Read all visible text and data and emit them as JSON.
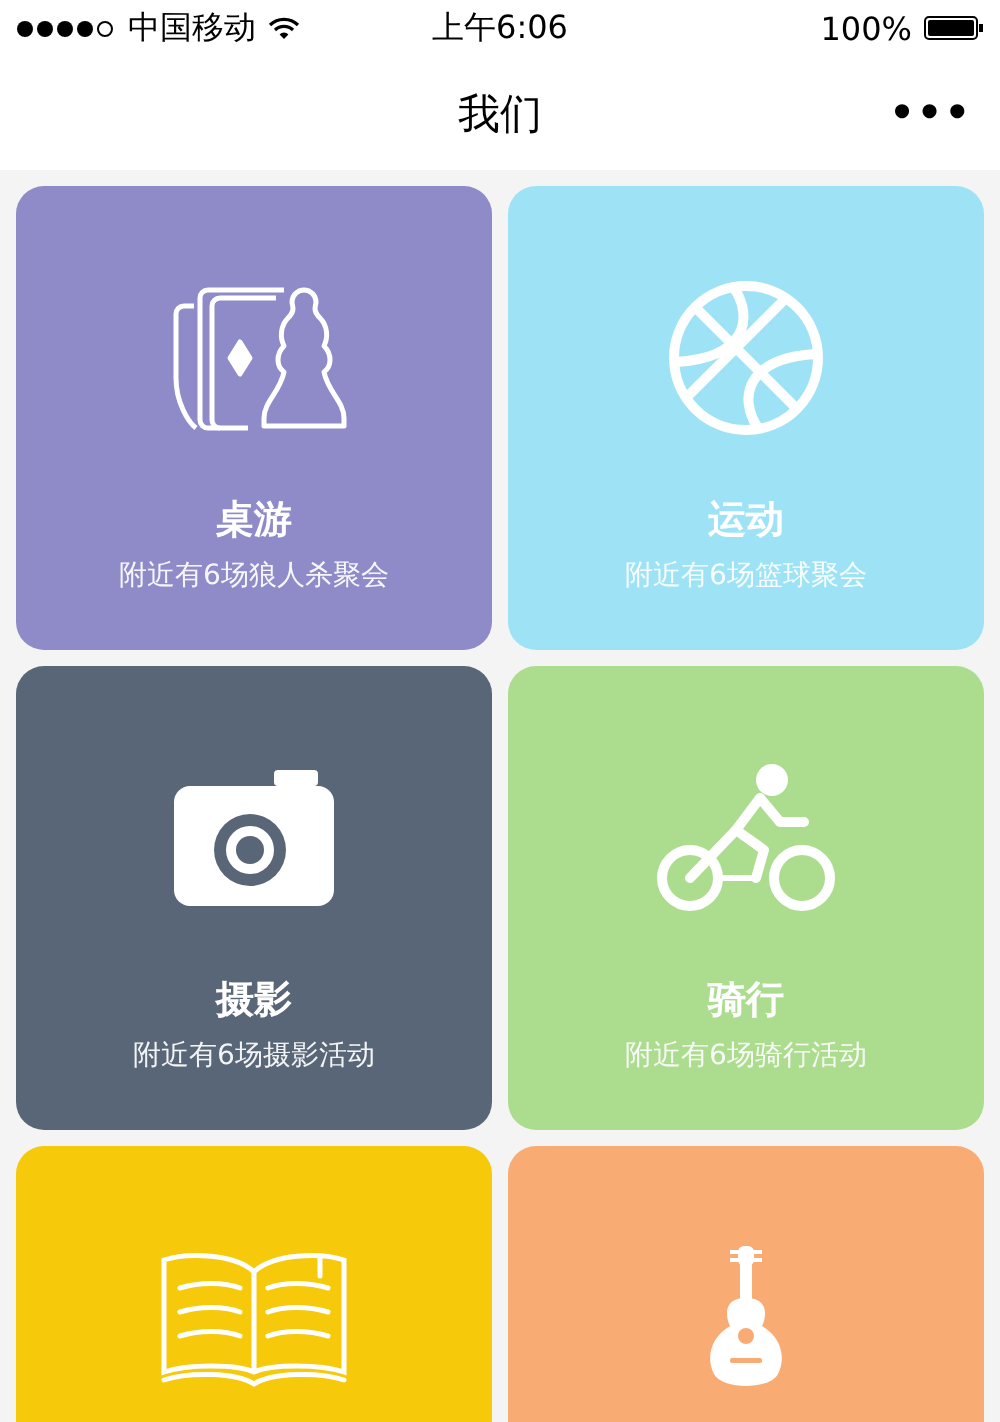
{
  "status_bar": {
    "carrier": "中国移动",
    "time": "上午6:06",
    "battery": "100%"
  },
  "nav_bar": {
    "title": "我们",
    "menu": "•••"
  },
  "cards": [
    {
      "kind": "boardgame",
      "color": "#8f8bc8",
      "title": "桌游",
      "subtitle": "附近有6场狼人杀聚会"
    },
    {
      "kind": "basketball",
      "color": "#9de3f5",
      "title": "运动",
      "subtitle": "附近有6场篮球聚会"
    },
    {
      "kind": "camera",
      "color": "#596677",
      "title": "摄影",
      "subtitle": "附近有6场摄影活动"
    },
    {
      "kind": "bicycle",
      "color": "#acdc8e",
      "title": "骑行",
      "subtitle": "附近有6场骑行活动"
    },
    {
      "kind": "book",
      "color": "#f6ca0a"
    },
    {
      "kind": "guitar",
      "color": "#f9ab74"
    }
  ]
}
